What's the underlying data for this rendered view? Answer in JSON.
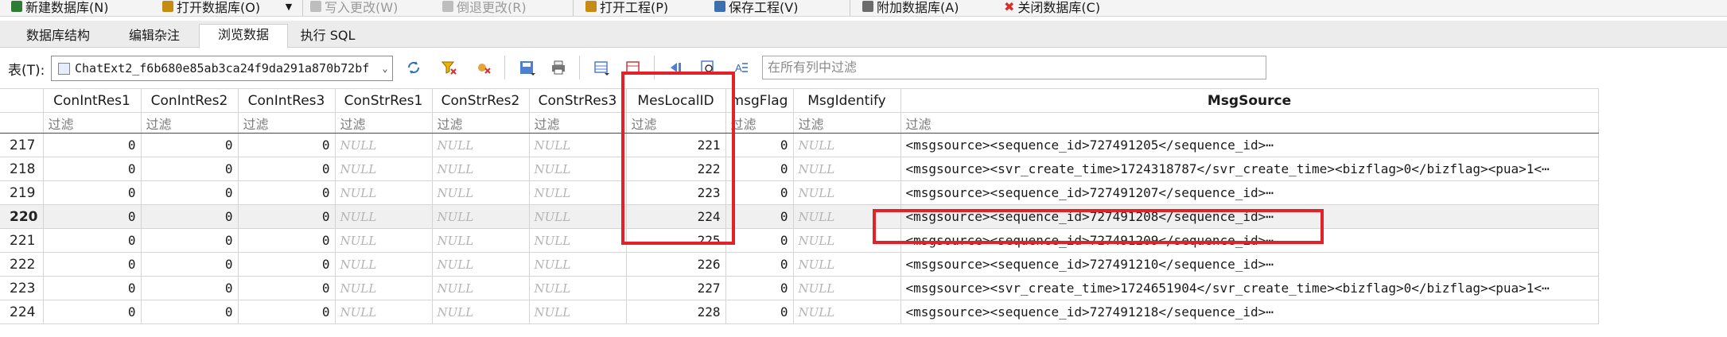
{
  "toolbar": {
    "items": [
      {
        "label": "新建数据库(N)",
        "icon_color": "#2e7d32",
        "enabled": true
      },
      {
        "label": "打开数据库(O)",
        "icon_color": "#c58b12",
        "enabled": true
      },
      {
        "label": "写入更改(W)",
        "icon_color": "#9e9e9e",
        "enabled": false
      },
      {
        "label": "倒退更改(R)",
        "icon_color": "#9e9e9e",
        "enabled": false
      },
      {
        "label": "打开工程(P)",
        "icon_color": "#c58b12",
        "enabled": true
      },
      {
        "label": "保存工程(V)",
        "icon_color": "#3a6fb0",
        "enabled": true
      },
      {
        "label": "附加数据库(A)",
        "icon_color": "#6b6b6b",
        "enabled": true
      },
      {
        "label": "关闭数据库(C)",
        "icon_color": "#d32f2f",
        "enabled": true
      }
    ]
  },
  "tabs": [
    {
      "label": "数据库结构",
      "active": false
    },
    {
      "label": "编辑杂注",
      "active": false
    },
    {
      "label": "浏览数据",
      "active": true
    },
    {
      "label": "执行 SQL",
      "active": false
    }
  ],
  "browse": {
    "table_label": "表(T):",
    "table_value": "ChatExt2_f6b680e85ab3ca24f9da291a870b72bf",
    "filter_all_placeholder": "在所有列中过滤"
  },
  "grid": {
    "columns": [
      "ConIntRes1",
      "ConIntRes2",
      "ConIntRes3",
      "ConStrRes1",
      "ConStrRes2",
      "ConStrRes3",
      "MesLocalID",
      "msgFlag",
      "MsgIdentify",
      "MsgSource"
    ],
    "filter_placeholder": "过滤",
    "null_text": "NULL",
    "selected_row": "220",
    "rows": [
      {
        "num": "217",
        "ConIntRes1": "0",
        "ConIntRes2": "0",
        "ConIntRes3": "0",
        "MesLocalID": "221",
        "msgFlag": "0",
        "MsgSource": "<msgsource><sequence_id>727491205</sequence_id>⋯"
      },
      {
        "num": "218",
        "ConIntRes1": "0",
        "ConIntRes2": "0",
        "ConIntRes3": "0",
        "MesLocalID": "222",
        "msgFlag": "0",
        "MsgSource": "<msgsource><svr_create_time>1724318787</svr_create_time><bizflag>0</bizflag><pua>1<⋯"
      },
      {
        "num": "219",
        "ConIntRes1": "0",
        "ConIntRes2": "0",
        "ConIntRes3": "0",
        "MesLocalID": "223",
        "msgFlag": "0",
        "MsgSource": "<msgsource><sequence_id>727491207</sequence_id>⋯"
      },
      {
        "num": "220",
        "ConIntRes1": "0",
        "ConIntRes2": "0",
        "ConIntRes3": "0",
        "MesLocalID": "224",
        "msgFlag": "0",
        "MsgSource": "<msgsource><sequence_id>727491208</sequence_id>⋯"
      },
      {
        "num": "221",
        "ConIntRes1": "0",
        "ConIntRes2": "0",
        "ConIntRes3": "0",
        "MesLocalID": "225",
        "msgFlag": "0",
        "MsgSource": "<msgsource><sequence_id>727491209</sequence_id>⋯"
      },
      {
        "num": "222",
        "ConIntRes1": "0",
        "ConIntRes2": "0",
        "ConIntRes3": "0",
        "MesLocalID": "226",
        "msgFlag": "0",
        "MsgSource": "<msgsource><sequence_id>727491210</sequence_id>⋯"
      },
      {
        "num": "223",
        "ConIntRes1": "0",
        "ConIntRes2": "0",
        "ConIntRes3": "0",
        "MesLocalID": "227",
        "msgFlag": "0",
        "MsgSource": "<msgsource><svr_create_time>1724651904</svr_create_time><bizflag>0</bizflag><pua>1<⋯"
      },
      {
        "num": "224",
        "ConIntRes1": "0",
        "ConIntRes2": "0",
        "ConIntRes3": "0",
        "MesLocalID": "228",
        "msgFlag": "0",
        "MsgSource": "<msgsource><sequence_id>727491218</sequence_id>⋯"
      }
    ]
  },
  "highlight_color": "#e12228"
}
